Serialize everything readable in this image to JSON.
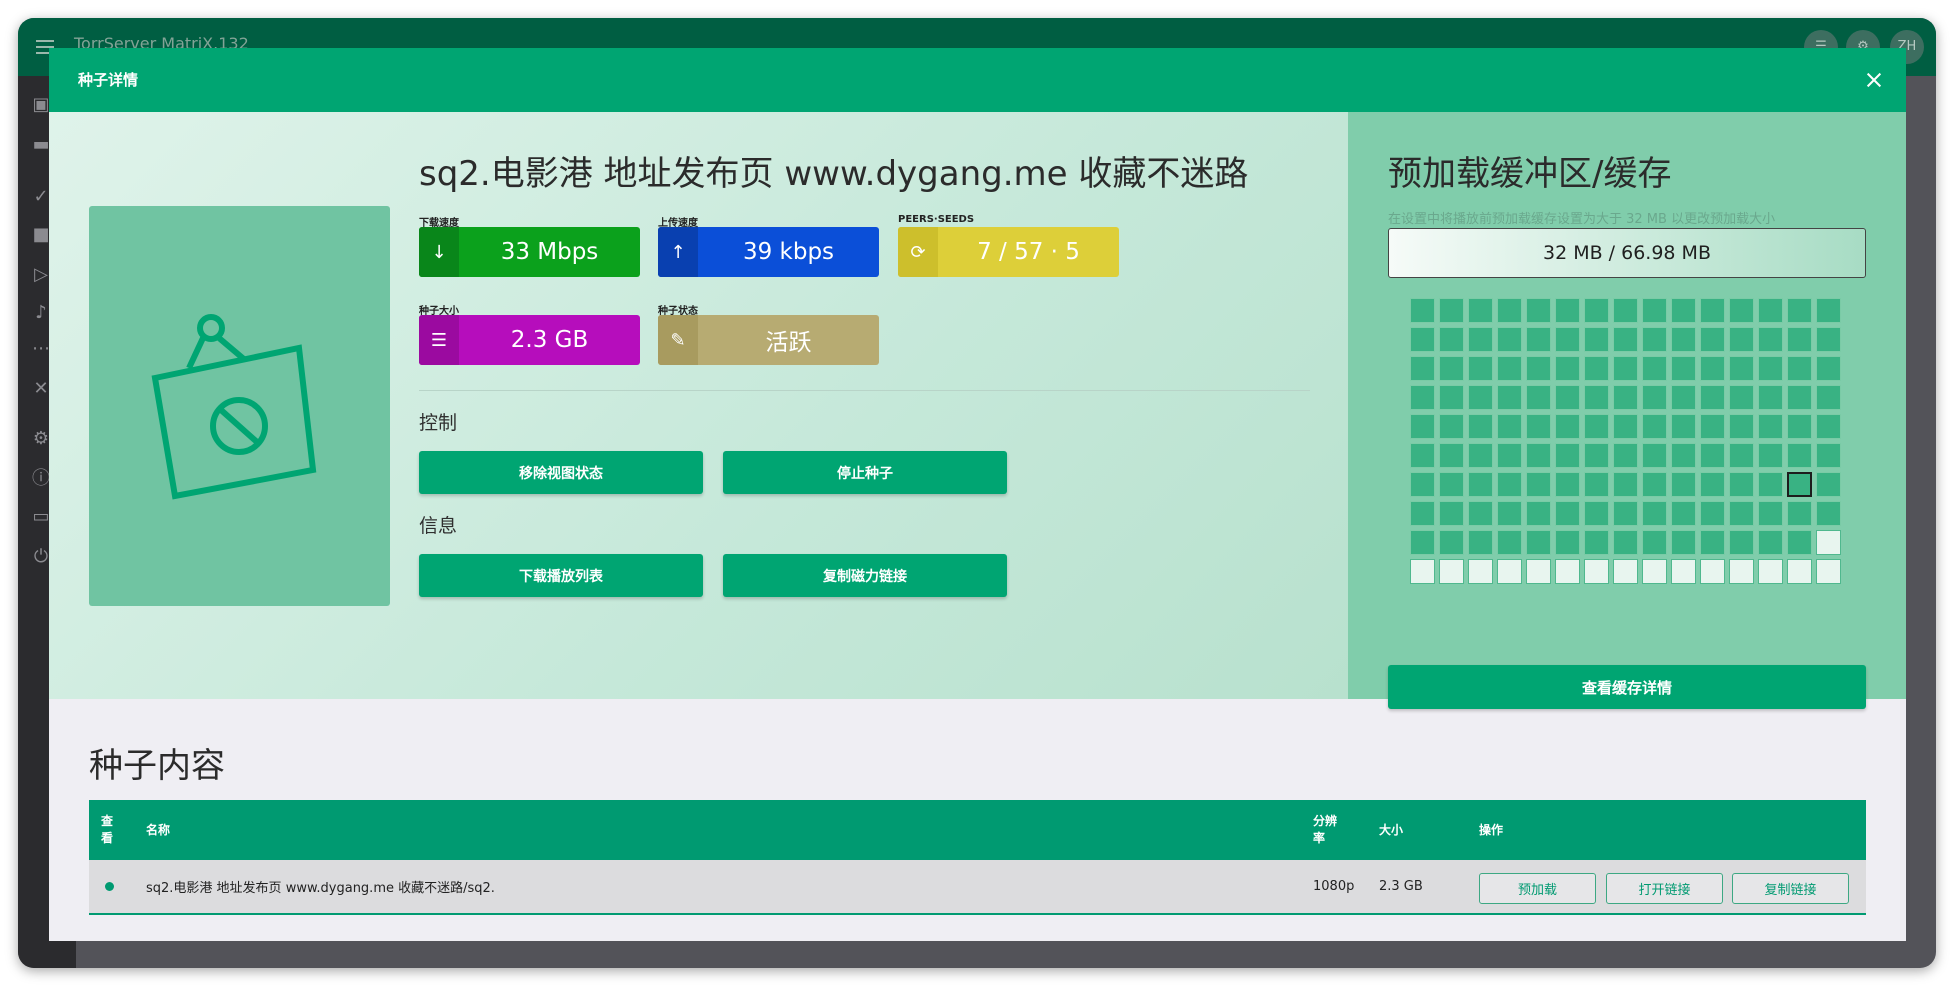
{
  "app": {
    "title": "TorrServer MatriX.132",
    "avatar_initials": "ZH"
  },
  "dialog": {
    "title": "种子详情"
  },
  "torrent": {
    "title": "sq2.电影港 地址发布页 www.dygang.me 收藏不迷路",
    "stats": [
      {
        "label": "下载速度",
        "value": "33 Mbps",
        "icon": "arrow-down-icon",
        "color": "#0ba11c"
      },
      {
        "label": "上传速度",
        "value": "39 kbps",
        "icon": "arrow-up-icon",
        "color": "#0b4fd8"
      },
      {
        "label": "PEERS·SEEDS",
        "value": "7 / 57 · 5",
        "icon": "peers-icon",
        "color": "#ddcf39"
      },
      {
        "label": "种子大小",
        "value": "2.3 GB",
        "icon": "storage-icon",
        "color": "#b60dbc"
      },
      {
        "label": "种子状态",
        "value": "活跃",
        "icon": "wrench-icon",
        "color": "#b7ab72"
      }
    ]
  },
  "controls": {
    "heading": "控制",
    "remove_view_state": "移除视图状态",
    "stop_torrent": "停止种子"
  },
  "info": {
    "heading": "信息",
    "download_playlist": "下载播放列表",
    "copy_magnet": "复制磁力链接"
  },
  "cache": {
    "title": "预加载缓冲区/缓存",
    "hint": "在设置中将播放前预加载缓存设置为大于 32 MB 以更改预加载大小",
    "usage": "32 MB / 66.98 MB",
    "details_button": "查看缓存详情",
    "fill_fraction": 0.478
  },
  "content": {
    "title": "种子内容",
    "columns": {
      "viewed": "查看",
      "name": "名称",
      "resolution": "分辨率",
      "size": "大小",
      "actions": "操作"
    },
    "rows": [
      {
        "name": "sq2.电影港 地址发布页 www.dygang.me 收藏不迷路/sq2.",
        "resolution": "1080p",
        "size": "2.3 GB",
        "preload": "预加载",
        "open_link": "打开链接",
        "copy_link": "复制链接"
      }
    ]
  },
  "colors": {
    "primary": "#00a572",
    "header_dark": "#005e42",
    "table_header": "#009a71"
  }
}
